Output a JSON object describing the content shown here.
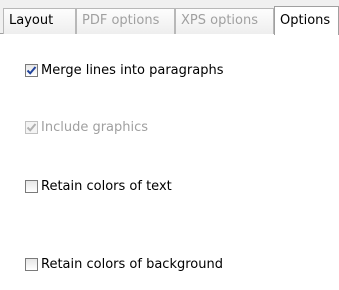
{
  "tabs": [
    {
      "label": "Layout",
      "state": "normal"
    },
    {
      "label": "PDF options",
      "state": "disabled"
    },
    {
      "label": "XPS options",
      "state": "disabled"
    },
    {
      "label": "Options",
      "state": "selected"
    }
  ],
  "options": [
    {
      "label": "Merge lines into paragraphs",
      "checked": true,
      "enabled": true
    },
    {
      "label": "Include graphics",
      "checked": true,
      "enabled": false
    },
    {
      "label": "Retain colors of text",
      "checked": false,
      "enabled": true
    },
    {
      "label": "Retain colors of background",
      "checked": false,
      "enabled": true
    }
  ],
  "colors": {
    "check_mark": "#21439c",
    "check_mark_disabled": "#b0b0b0",
    "disabled_text": "#a0a0a0"
  }
}
